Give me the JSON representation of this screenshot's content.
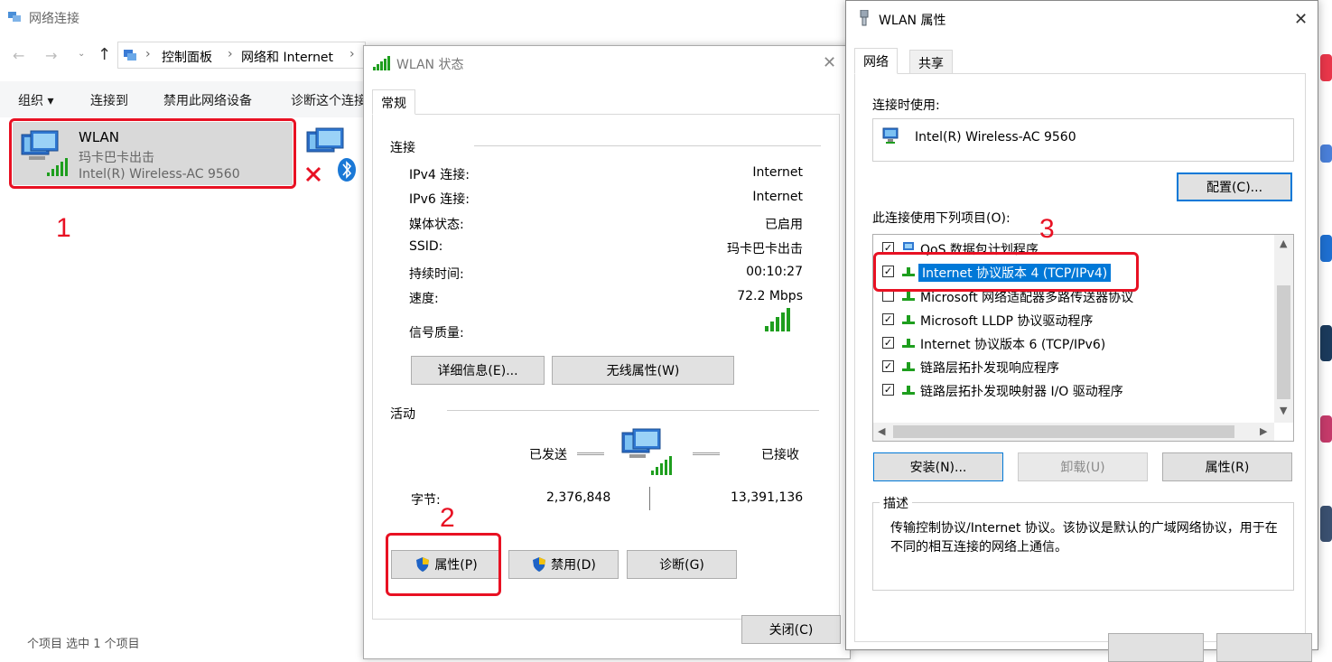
{
  "explorer": {
    "title": "网络连接",
    "breadcrumb": [
      "控制面板",
      "网络和 Internet"
    ],
    "commands": [
      "组织 ▾",
      "连接到",
      "禁用此网络设备",
      "诊断这个连接"
    ],
    "wlan_item": {
      "name": "WLAN",
      "ssid": "玛卡巴卡出击",
      "adapter": "Intel(R) Wireless-AC 9560"
    },
    "bottom_text": "个项目    选中 1 个项目"
  },
  "annotations": {
    "step1": "1",
    "step2": "2",
    "step3": "3"
  },
  "status_dialog": {
    "title": "WLAN 状态",
    "tab": "常规",
    "connection_group": "连接",
    "rows": [
      {
        "label": "IPv4 连接:",
        "value": "Internet"
      },
      {
        "label": "IPv6 连接:",
        "value": "Internet"
      },
      {
        "label": "媒体状态:",
        "value": "已启用"
      },
      {
        "label": "SSID:",
        "value": "玛卡巴卡出击"
      },
      {
        "label": "持续时间:",
        "value": "00:10:27"
      },
      {
        "label": "速度:",
        "value": "72.2 Mbps"
      }
    ],
    "signal_label": "信号质量:",
    "details_button": "详细信息(E)...",
    "wireless_props_button": "无线属性(W)",
    "activity_group": "活动",
    "sent_label": "已发送",
    "received_label": "已接收",
    "bytes_label": "字节:",
    "bytes_sent": "2,376,848",
    "bytes_received": "13,391,136",
    "properties_button": "属性(P)",
    "disable_button": "禁用(D)",
    "diagnose_button": "诊断(G)",
    "close_button": "关闭(C)"
  },
  "props_dialog": {
    "title": "WLAN 属性",
    "tabs": [
      "网络",
      "共享"
    ],
    "connect_using_label": "连接时使用:",
    "adapter": "Intel(R) Wireless-AC 9560",
    "configure_button": "配置(C)...",
    "items_label": "此连接使用下列项目(O):",
    "items": [
      {
        "checked": true,
        "text": "QoS 数据包计划程序",
        "selected": false
      },
      {
        "checked": true,
        "text": "Internet 协议版本 4 (TCP/IPv4)",
        "selected": true
      },
      {
        "checked": false,
        "text": "Microsoft 网络适配器多路传送器协议",
        "selected": false
      },
      {
        "checked": true,
        "text": "Microsoft LLDP 协议驱动程序",
        "selected": false
      },
      {
        "checked": true,
        "text": "Internet 协议版本 6 (TCP/IPv6)",
        "selected": false
      },
      {
        "checked": true,
        "text": "链路层拓扑发现响应程序",
        "selected": false
      },
      {
        "checked": true,
        "text": "链路层拓扑发现映射器 I/O 驱动程序",
        "selected": false
      }
    ],
    "install_button": "安装(N)...",
    "uninstall_button": "卸载(U)",
    "properties_button": "属性(R)",
    "description_label": "描述",
    "description_text": "传输控制协议/Internet 协议。该协议是默认的广域网络协议，用于在不同的相互连接的网络上通信。"
  },
  "colors": {
    "accent": "#0078d7",
    "annotation_red": "#e81123",
    "signal_green": "#1e9e1e"
  }
}
